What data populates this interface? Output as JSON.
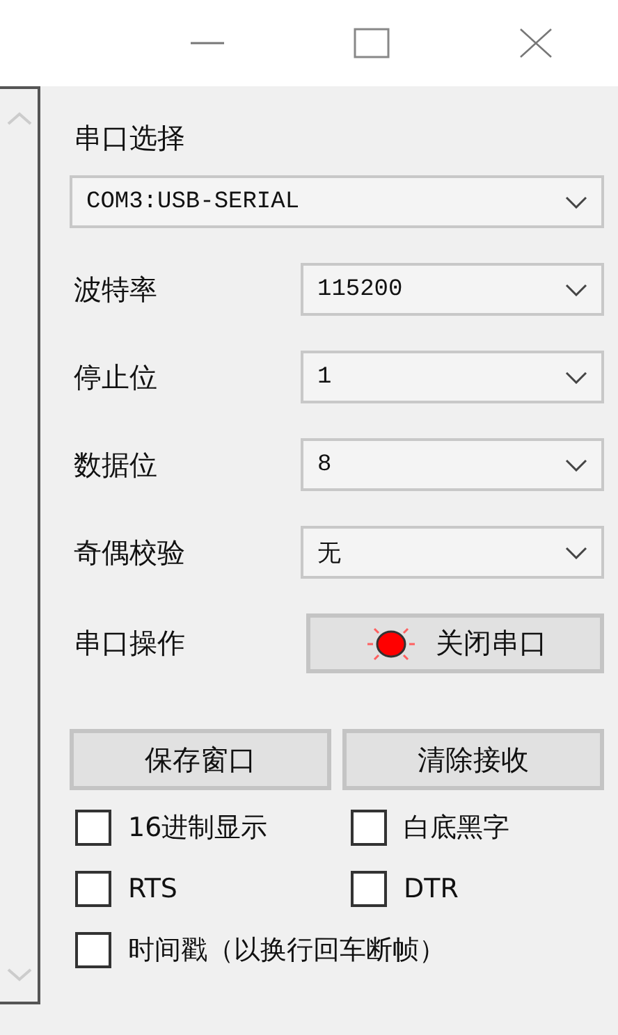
{
  "port_section": {
    "label": "串口选择",
    "port": "COM3:USB-SERIAL"
  },
  "settings": [
    {
      "label": "波特率",
      "value": "115200"
    },
    {
      "label": "停止位",
      "value": "1"
    },
    {
      "label": "数据位",
      "value": "8"
    },
    {
      "label": "奇偶校验",
      "value": "无"
    }
  ],
  "operation": {
    "label": "串口操作",
    "button": "关闭串口",
    "lamp_on": true
  },
  "buttons": [
    "保存窗口",
    "清除接收"
  ],
  "checkboxes": [
    {
      "label": "16进制显示",
      "checked": false
    },
    {
      "label": "白底黑字",
      "checked": false
    },
    {
      "label": "RTS",
      "checked": false
    },
    {
      "label": "DTR",
      "checked": false
    },
    {
      "label": "时间戳（以换行回车断帧）",
      "checked": false
    }
  ]
}
